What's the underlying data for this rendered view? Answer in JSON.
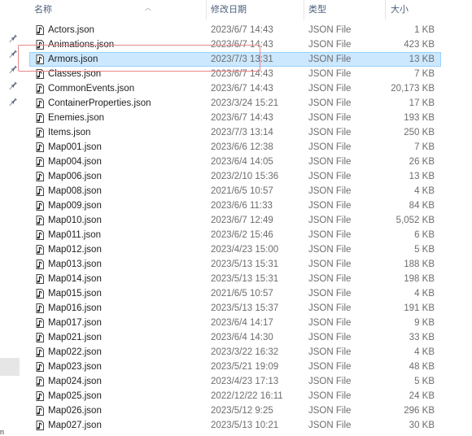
{
  "header": {
    "name": "名称",
    "date": "修改日期",
    "type": "类型",
    "size": "大小"
  },
  "files": [
    {
      "name": "Actors.json",
      "date": "2023/6/7 14:43",
      "type": "JSON File",
      "size": "1 KB"
    },
    {
      "name": "Animations.json",
      "date": "2023/6/7 14:43",
      "type": "JSON File",
      "size": "423 KB"
    },
    {
      "name": "Armors.json",
      "date": "2023/7/3 13:31",
      "type": "JSON File",
      "size": "13 KB",
      "selected": true
    },
    {
      "name": "Classes.json",
      "date": "2023/6/7 14:43",
      "type": "JSON File",
      "size": "7 KB"
    },
    {
      "name": "CommonEvents.json",
      "date": "2023/6/7 14:43",
      "type": "JSON File",
      "size": "20,173 KB"
    },
    {
      "name": "ContainerProperties.json",
      "date": "2023/3/24 15:21",
      "type": "JSON File",
      "size": "17 KB"
    },
    {
      "name": "Enemies.json",
      "date": "2023/6/7 14:43",
      "type": "JSON File",
      "size": "193 KB"
    },
    {
      "name": "Items.json",
      "date": "2023/7/3 13:14",
      "type": "JSON File",
      "size": "250 KB"
    },
    {
      "name": "Map001.json",
      "date": "2023/6/6 12:38",
      "type": "JSON File",
      "size": "7 KB"
    },
    {
      "name": "Map004.json",
      "date": "2023/6/4 14:05",
      "type": "JSON File",
      "size": "26 KB"
    },
    {
      "name": "Map006.json",
      "date": "2023/2/10 15:36",
      "type": "JSON File",
      "size": "13 KB"
    },
    {
      "name": "Map008.json",
      "date": "2021/6/5 10:57",
      "type": "JSON File",
      "size": "4 KB"
    },
    {
      "name": "Map009.json",
      "date": "2023/6/6 11:33",
      "type": "JSON File",
      "size": "84 KB"
    },
    {
      "name": "Map010.json",
      "date": "2023/6/7 12:49",
      "type": "JSON File",
      "size": "5,052 KB"
    },
    {
      "name": "Map011.json",
      "date": "2023/6/2 15:46",
      "type": "JSON File",
      "size": "6 KB"
    },
    {
      "name": "Map012.json",
      "date": "2023/4/23 15:00",
      "type": "JSON File",
      "size": "5 KB"
    },
    {
      "name": "Map013.json",
      "date": "2023/5/13 15:31",
      "type": "JSON File",
      "size": "188 KB"
    },
    {
      "name": "Map014.json",
      "date": "2023/5/13 15:31",
      "type": "JSON File",
      "size": "198 KB"
    },
    {
      "name": "Map015.json",
      "date": "2021/6/5 10:57",
      "type": "JSON File",
      "size": "4 KB"
    },
    {
      "name": "Map016.json",
      "date": "2023/5/13 15:37",
      "type": "JSON File",
      "size": "191 KB"
    },
    {
      "name": "Map017.json",
      "date": "2023/6/4 14:17",
      "type": "JSON File",
      "size": "9 KB"
    },
    {
      "name": "Map021.json",
      "date": "2023/6/4 14:30",
      "type": "JSON File",
      "size": "33 KB"
    },
    {
      "name": "Map022.json",
      "date": "2023/3/22 16:32",
      "type": "JSON File",
      "size": "4 KB"
    },
    {
      "name": "Map023.json",
      "date": "2023/5/21 19:09",
      "type": "JSON File",
      "size": "48 KB"
    },
    {
      "name": "Map024.json",
      "date": "2023/4/23 17:13",
      "type": "JSON File",
      "size": "5 KB"
    },
    {
      "name": "Map025.json",
      "date": "2022/12/22 16:11",
      "type": "JSON File",
      "size": "24 KB"
    },
    {
      "name": "Map026.json",
      "date": "2023/5/12 9:25",
      "type": "JSON File",
      "size": "296 KB"
    },
    {
      "name": "Map027.json",
      "date": "2023/5/13 10:21",
      "type": "JSON File",
      "size": "30 KB"
    }
  ],
  "nav": {
    "bottom_letter": "n"
  },
  "colors": {
    "selection": "#cce8ff",
    "highlight_box": "#e8868a"
  }
}
